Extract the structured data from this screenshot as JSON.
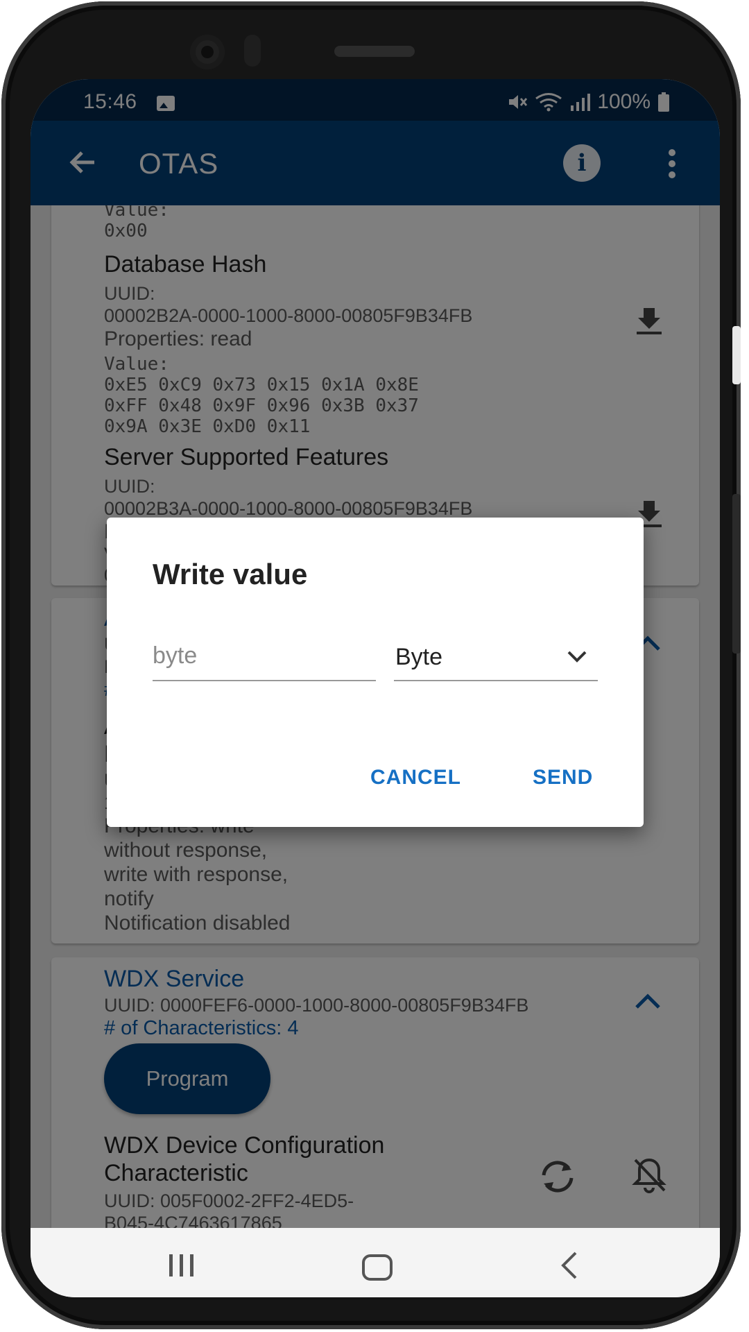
{
  "status_bar": {
    "time": "15:46",
    "battery": "100%",
    "icons": [
      "image-notification-icon",
      "mute-icon",
      "wifi-icon",
      "signal-icon",
      "battery-icon"
    ]
  },
  "app_bar": {
    "title": "OTAS",
    "icons": [
      "back-arrow-icon",
      "info-icon",
      "more-vert-icon"
    ],
    "color": "#034078"
  },
  "content": {
    "partial_value_label": "Value:",
    "partial_value": "0x00",
    "database_hash": {
      "name": "Database Hash",
      "uuid_label": "UUID:",
      "uuid": "00002B2A-0000-1000-8000-00805F9B34FB",
      "properties": "Properties: read",
      "value_label": "Value:",
      "value_lines": [
        "0xE5 0xC9 0x73 0x15 0x1A 0x8E",
        "0xFF 0x48 0x9F 0x96 0x3B 0x37",
        "0x9A 0x3E 0xD0 0x11"
      ]
    },
    "server_features": {
      "name": "Server Supported Features",
      "uuid_label": "UUID:",
      "uuid": "00002B3A-0000-1000-8000-00805F9B34FB",
      "partial_1": "Pr",
      "partial_2": "Va",
      "partial_3": "0x"
    },
    "second_service": {
      "title_partial": "A",
      "line1_partial": "UU",
      "line2_partial": "E0",
      "count_partial": "#",
      "char_line1_partial": "A",
      "char_line2_partial": "D",
      "char_uuid_partial": "UU",
      "char_uuid2_partial": "1-",
      "properties_lines": [
        "Properties: write",
        "without response,",
        "write with response,",
        "notify"
      ],
      "notification": "Notification disabled"
    },
    "wdx_service": {
      "title": "WDX Service",
      "uuid": "UUID: 0000FEF6-0000-1000-8000-00805F9B34FB",
      "count": "# of Characteristics: 4",
      "program_label": "Program",
      "char_name_line1": "WDX Device Configuration",
      "char_name_line2": "Characteristic",
      "char_uuid_line1": "UUID: 005F0002-2FF2-4ED5-",
      "char_uuid_line2": "B045-4C7463617865"
    }
  },
  "dialog": {
    "title": "Write value",
    "input_placeholder": "byte",
    "input_value": "",
    "type_selected": "Byte",
    "cancel_label": "CANCEL",
    "send_label": "SEND"
  },
  "navigation_bar": {
    "icons": [
      "recents-icon",
      "home-icon",
      "back-icon"
    ]
  }
}
